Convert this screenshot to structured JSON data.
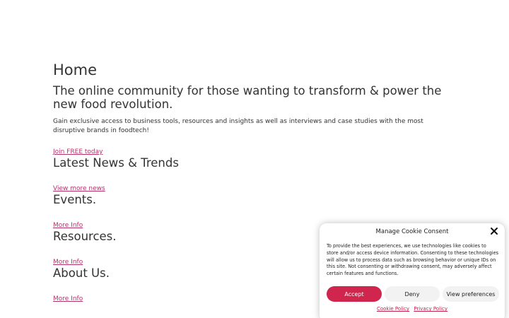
{
  "main": {
    "title": "Home",
    "tagline": "The online community for those wanting to transform & power the new food revolution.",
    "intro": "Gain exclusive access to business tools, resources and insights as well as interviews and case studies with the most disruptive brands in foodtech!",
    "join_link": "Join FREE today",
    "sections": [
      {
        "heading": "Latest News & Trends",
        "link": "View more news"
      },
      {
        "heading": "Events.",
        "link": "More Info"
      },
      {
        "heading": "Resources.",
        "link": "More Info"
      },
      {
        "heading": "About Us.",
        "link": "More Info"
      }
    ]
  },
  "cookie": {
    "title": "Manage Cookie Consent",
    "close_icon": "close-icon",
    "text": "To provide the best experiences, we use technologies like cookies to store and/or access device information. Consenting to these technologies will allow us to process data such as browsing behavior or unique IDs on this site. Not consenting or withdrawing consent, may adversely affect certain features and functions.",
    "accept": "Accept",
    "deny": "Deny",
    "preferences": "View preferences",
    "cookie_policy": "Cookie Policy",
    "privacy_policy": "Privacy Policy"
  },
  "colors": {
    "link": "#b5336b",
    "accept_bg": "#d0264d"
  }
}
